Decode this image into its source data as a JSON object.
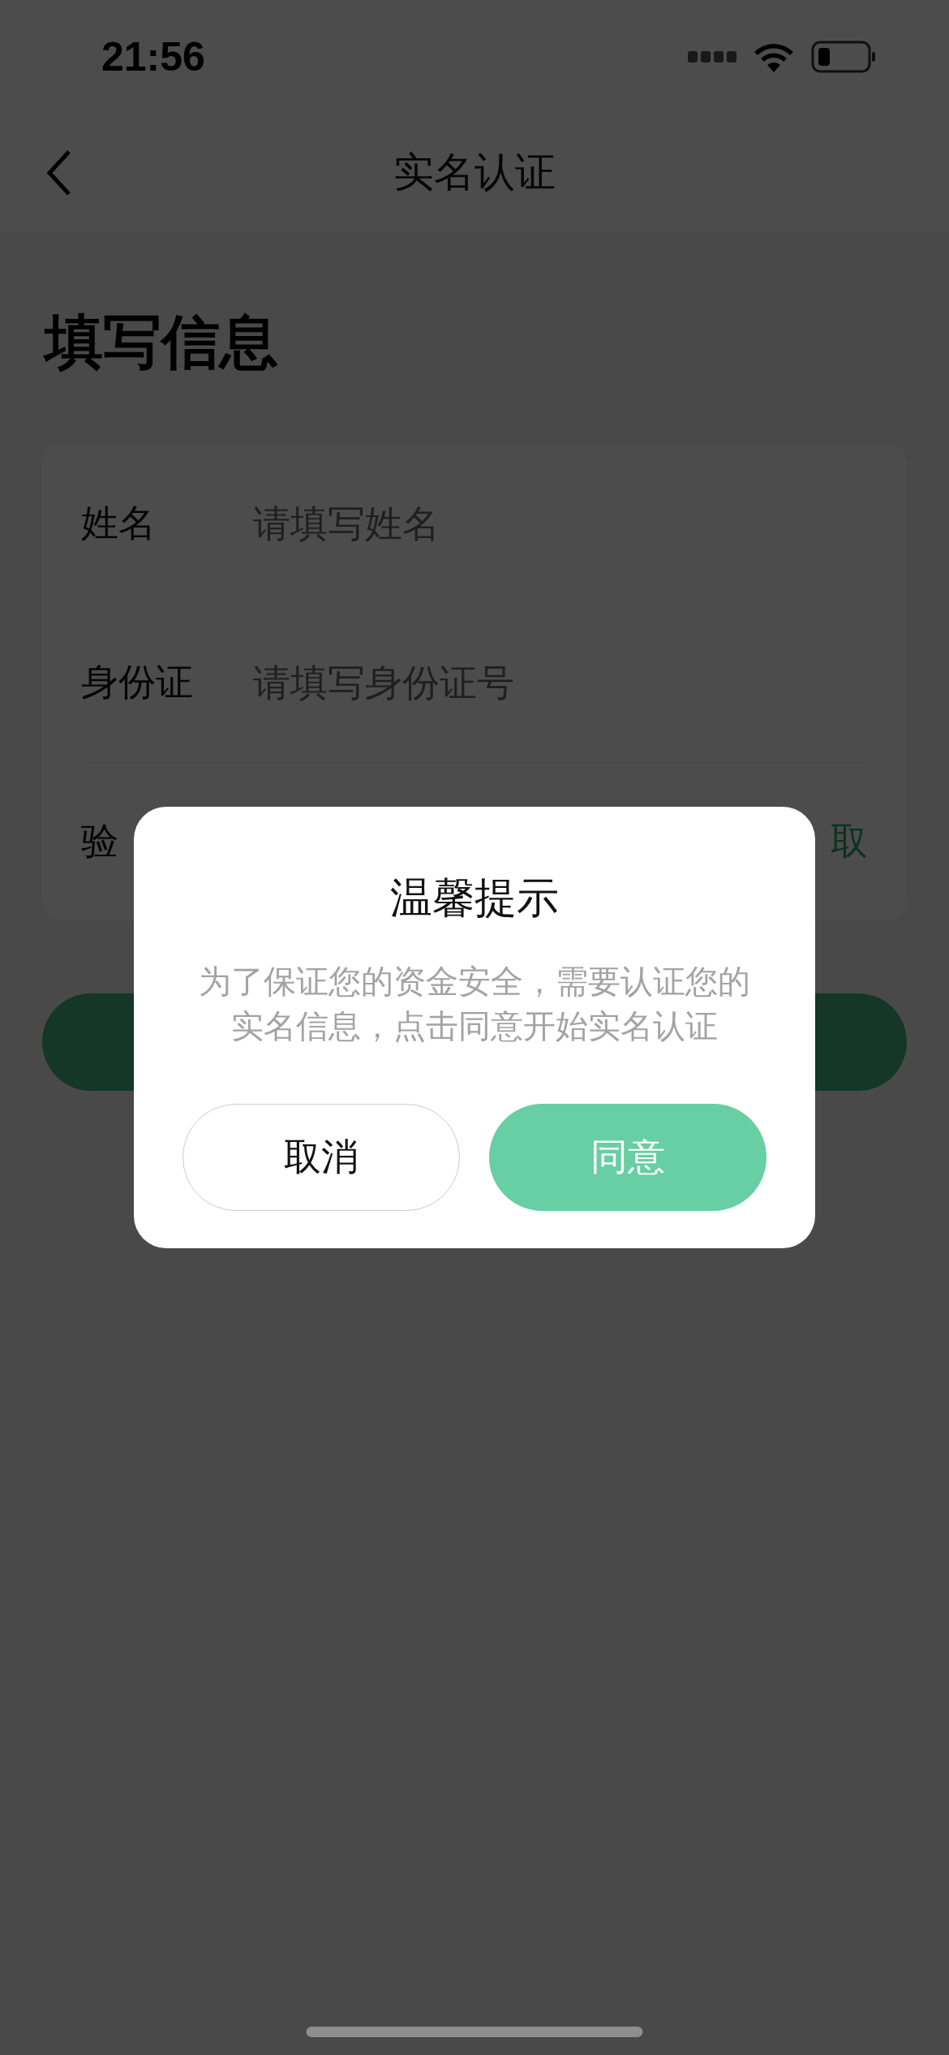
{
  "status_bar": {
    "time": "21:56"
  },
  "nav": {
    "title": "实名认证"
  },
  "heading": "填写信息",
  "form": {
    "rows": [
      {
        "kind": "input",
        "label": "姓名",
        "placeholder": "请填写姓名"
      },
      {
        "kind": "input",
        "label": "身份证",
        "placeholder": "请填写身份证号"
      },
      {
        "kind": "code",
        "label": "验",
        "action": "取"
      }
    ]
  },
  "dialog": {
    "title": "温馨提示",
    "message": "为了保证您的资金安全，需要认证您的实名信息，点击同意开始实名认证",
    "buttons": [
      {
        "kind": "secondary",
        "label": "取消"
      },
      {
        "kind": "primary",
        "label": "同意"
      }
    ]
  }
}
